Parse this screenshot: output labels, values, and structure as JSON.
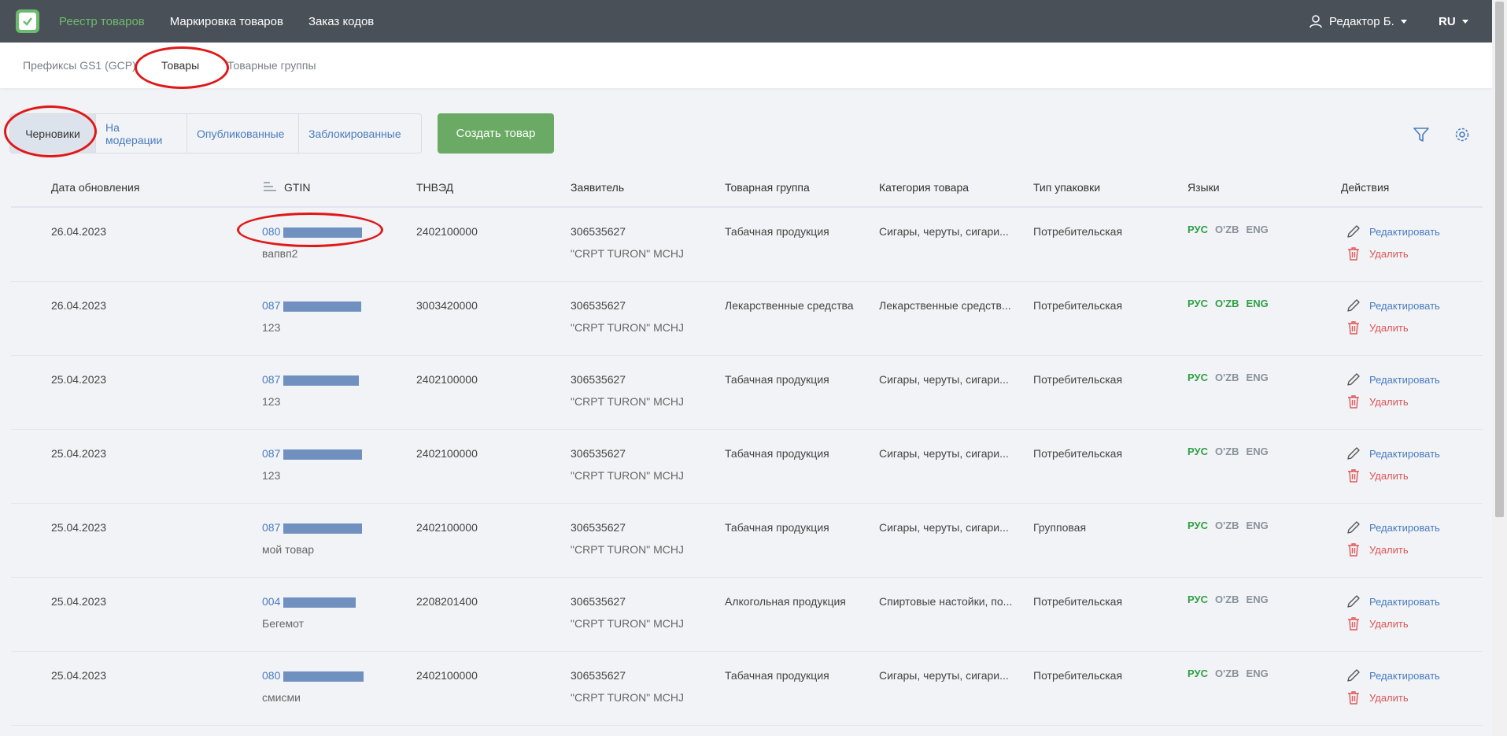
{
  "topbar": {
    "nav": [
      "Реестр товаров",
      "Маркировка товаров",
      "Заказ кодов"
    ],
    "user": "Редактор Б.",
    "lang": "RU"
  },
  "subnav": {
    "tabs": [
      "Префиксы GS1 (GCP)",
      "Товары",
      "Товарные группы"
    ]
  },
  "status_filters": [
    "Черновики",
    "На модерации",
    "Опубликованные",
    "Заблокированные"
  ],
  "create_button": "Создать товар",
  "table": {
    "headers": [
      "Дата обновления",
      "GTIN",
      "ТНВЭД",
      "Заявитель",
      "Товарная группа",
      "Категория товара",
      "Тип упаковки",
      "Языки",
      "Действия"
    ],
    "rows": [
      {
        "date": "26.04.2023",
        "gtin": "080",
        "name": "вапвп2",
        "tnved": "2402100000",
        "applicant": "306535627",
        "applicant_name": "\"CRPT TURON\" MCHJ",
        "group": "Табачная продукция",
        "category": "Сигары, черуты, сигари...",
        "pack": "Потребительская",
        "langs": [
          "РУС",
          "O'ZB",
          "ENG"
        ],
        "langs_on": [
          true,
          false,
          false
        ]
      },
      {
        "date": "26.04.2023",
        "gtin": "087",
        "name": "123",
        "tnved": "3003420000",
        "applicant": "306535627",
        "applicant_name": "\"CRPT TURON\" MCHJ",
        "group": "Лекарственные средства",
        "category": "Лекарственные средств...",
        "pack": "Потребительская",
        "langs": [
          "РУС",
          "O'ZB",
          "ENG"
        ],
        "langs_on": [
          true,
          true,
          true
        ]
      },
      {
        "date": "25.04.2023",
        "gtin": "087",
        "name": "123",
        "tnved": "2402100000",
        "applicant": "306535627",
        "applicant_name": "\"CRPT TURON\" MCHJ",
        "group": "Табачная продукция",
        "category": "Сигары, черуты, сигари...",
        "pack": "Потребительская",
        "langs": [
          "РУС",
          "O'ZB",
          "ENG"
        ],
        "langs_on": [
          true,
          false,
          false
        ]
      },
      {
        "date": "25.04.2023",
        "gtin": "087",
        "name": "123",
        "tnved": "2402100000",
        "applicant": "306535627",
        "applicant_name": "\"CRPT TURON\" MCHJ",
        "group": "Табачная продукция",
        "category": "Сигары, черуты, сигари...",
        "pack": "Потребительская",
        "langs": [
          "РУС",
          "O'ZB",
          "ENG"
        ],
        "langs_on": [
          true,
          false,
          false
        ]
      },
      {
        "date": "25.04.2023",
        "gtin": "087",
        "name": "мой товар",
        "tnved": "2402100000",
        "applicant": "306535627",
        "applicant_name": "\"CRPT TURON\" MCHJ",
        "group": "Табачная продукция",
        "category": "Сигары, черуты, сигари...",
        "pack": "Групповая",
        "langs": [
          "РУС",
          "O'ZB",
          "ENG"
        ],
        "langs_on": [
          true,
          false,
          false
        ]
      },
      {
        "date": "25.04.2023",
        "gtin": "004",
        "name": "Бегемот",
        "tnved": "2208201400",
        "applicant": "306535627",
        "applicant_name": "\"CRPT TURON\" MCHJ",
        "group": "Алкогольная продукция",
        "category": "Спиртовые настойки, по...",
        "pack": "Потребительская",
        "langs": [
          "РУС",
          "O'ZB",
          "ENG"
        ],
        "langs_on": [
          true,
          false,
          false
        ]
      },
      {
        "date": "25.04.2023",
        "gtin": "080",
        "name": "смисми",
        "tnved": "2402100000",
        "applicant": "306535627",
        "applicant_name": "\"CRPT TURON\" MCHJ",
        "group": "Табачная продукция",
        "category": "Сигары, черуты, сигари...",
        "pack": "Потребительская",
        "langs": [
          "РУС",
          "O'ZB",
          "ENG"
        ],
        "langs_on": [
          true,
          false,
          false
        ]
      }
    ],
    "edit_label": "Редактировать",
    "delete_label": "Удалить"
  },
  "colors": {
    "topbar": "#4a5058",
    "accent_green": "#6aaa64",
    "link_blue": "#4a7cc0",
    "delete_red": "#e05555",
    "annotation_red": "#e01818"
  }
}
